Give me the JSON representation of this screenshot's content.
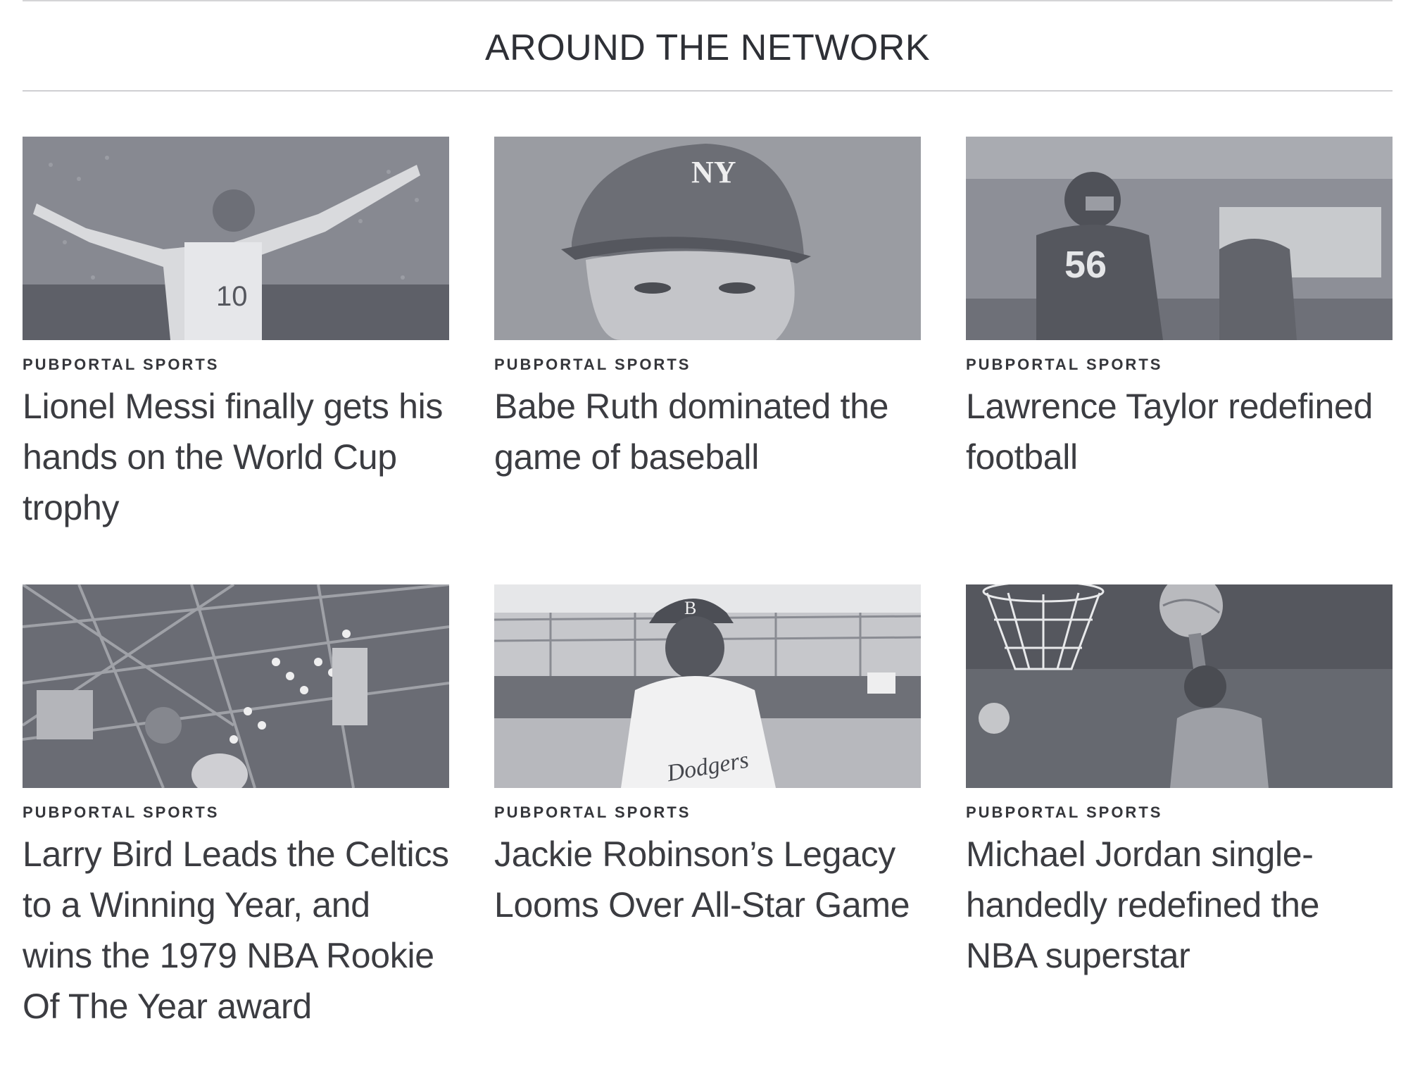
{
  "section": {
    "title": "AROUND THE NETWORK"
  },
  "cards": [
    {
      "kicker": "PUBPORTAL SPORTS",
      "headline": "Lionel Messi finally gets his hands on the World Cup trophy",
      "image_icon": "soccer-player-celebrating-photo",
      "jersey_number": "10"
    },
    {
      "kicker": "PUBPORTAL SPORTS",
      "headline": "Babe Ruth dominated the game of baseball",
      "image_icon": "baseball-player-portrait-photo",
      "cap_logo": "NY"
    },
    {
      "kicker": "PUBPORTAL SPORTS",
      "headline": "Lawrence Taylor redefined football",
      "image_icon": "football-player-running-photo",
      "jersey_number": "56"
    },
    {
      "kicker": "PUBPORTAL SPORTS",
      "headline": "Larry Bird Leads the Celtics to a Winning Year, and wins the 1979 NBA Rookie Of The Year award",
      "image_icon": "basketball-arena-photo"
    },
    {
      "kicker": "PUBPORTAL SPORTS",
      "headline": "Jackie Robinson’s Legacy Looms Over All-Star Game",
      "image_icon": "baseball-player-dodgers-photo",
      "cap_logo": "B",
      "jersey_text": "Dodgers"
    },
    {
      "kicker": "PUBPORTAL SPORTS",
      "headline": "Michael Jordan single-handedly redefined the NBA superstar",
      "image_icon": "basketball-dunk-photo"
    }
  ],
  "colors": {
    "text": "#3b3c41",
    "rule": "#cfcfd2",
    "photo_tint": "#9a9ca3"
  }
}
